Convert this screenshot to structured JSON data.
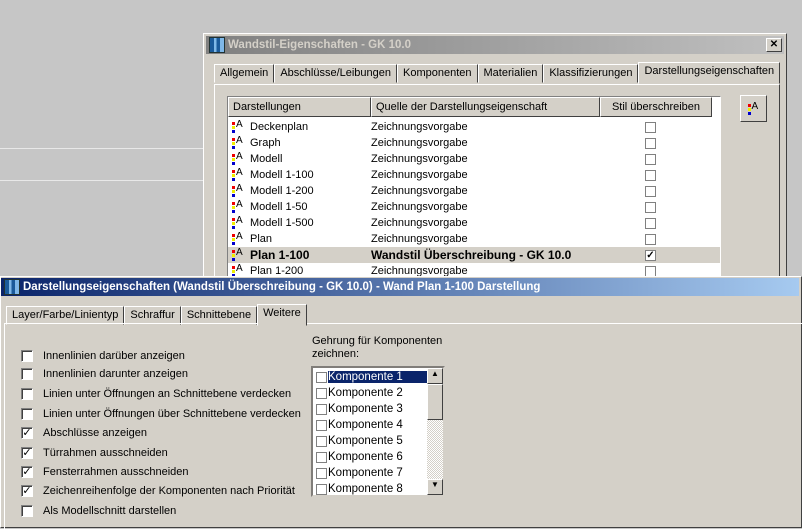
{
  "top_dialog": {
    "title": "Wandstil-Eigenschaften - GK 10.0",
    "close": "✕",
    "tabs": [
      "Allgemein",
      "Abschlüsse/Leibungen",
      "Komponenten",
      "Materialien",
      "Klassifizierungen",
      "Darstellungseigenschaften"
    ],
    "columns": [
      "Darstellungen",
      "Quelle der Darstellungseigenschaft",
      "Stil überschreiben"
    ],
    "rows": [
      {
        "name": "Deckenplan",
        "source": "Zeichnungsvorgabe",
        "override": false
      },
      {
        "name": "Graph",
        "source": "Zeichnungsvorgabe",
        "override": false
      },
      {
        "name": "Modell",
        "source": "Zeichnungsvorgabe",
        "override": false
      },
      {
        "name": "Modell 1-100",
        "source": "Zeichnungsvorgabe",
        "override": false
      },
      {
        "name": "Modell 1-200",
        "source": "Zeichnungsvorgabe",
        "override": false
      },
      {
        "name": "Modell 1-50",
        "source": "Zeichnungsvorgabe",
        "override": false
      },
      {
        "name": "Modell 1-500",
        "source": "Zeichnungsvorgabe",
        "override": false
      },
      {
        "name": "Plan",
        "source": "Zeichnungsvorgabe",
        "override": false
      },
      {
        "name": "Plan 1-100",
        "source": "Wandstil Überschreibung - GK 10.0",
        "override": true
      },
      {
        "name": "Plan 1-200",
        "source": "Zeichnungsvorgabe",
        "override": false
      }
    ]
  },
  "bottom_dialog": {
    "title": "Darstellungseigenschaften (Wandstil Überschreibung - GK 10.0) - Wand Plan 1-100 Darstellung",
    "tabs": [
      "Layer/Farbe/Linientyp",
      "Schraffur",
      "Schnittebene",
      "Weitere"
    ],
    "options": [
      {
        "label": "Innenlinien darüber anzeigen",
        "checked": false
      },
      {
        "label": "Innenlinien darunter anzeigen",
        "checked": false
      },
      {
        "label": "Linien unter Öffnungen an Schnittebene verdecken",
        "checked": false
      },
      {
        "label": "Linien unter Öffnungen über Schnittebene verdecken",
        "checked": false
      },
      {
        "label": "Abschlüsse anzeigen",
        "checked": true
      },
      {
        "label": "Türrahmen ausschneiden",
        "checked": true
      },
      {
        "label": "Fensterrahmen ausschneiden",
        "checked": true
      },
      {
        "label": "Zeichenreihenfolge der Komponenten nach Priorität",
        "checked": true
      },
      {
        "label": "Als Modellschnitt darstellen",
        "checked": false
      }
    ],
    "miter_label": "Gehrung für Komponenten zeichnen:",
    "components": [
      "Komponente 1",
      "Komponente 2",
      "Komponente 3",
      "Komponente 4",
      "Komponente 5",
      "Komponente 6",
      "Komponente 7",
      "Komponente 8"
    ]
  }
}
